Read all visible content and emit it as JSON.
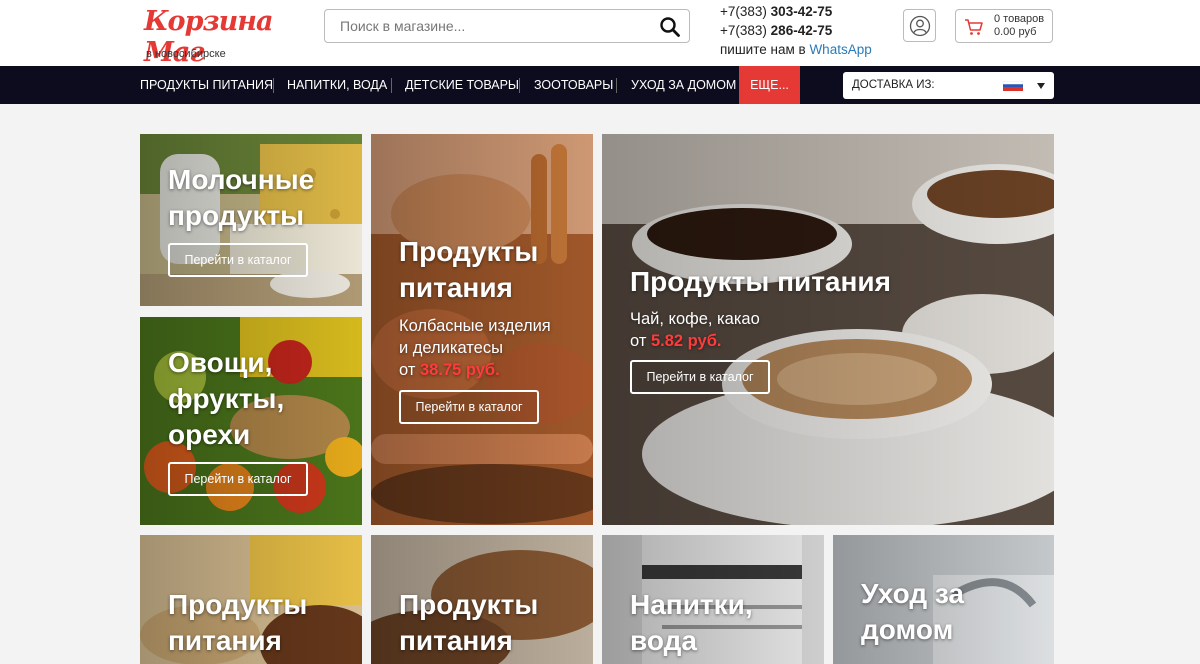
{
  "header": {
    "logo": "Корзина Маг",
    "city": "в новосибирске",
    "search_placeholder": "Поиск в магазине...",
    "phone1_prefix": "+7(383) ",
    "phone1_number": "303-42-75",
    "phone2_prefix": "+7(383) ",
    "phone2_number": "286-42-75",
    "whatsapp_prefix": "пишите нам в ",
    "whatsapp_link": "WhatsApp",
    "cart_count": "0 товаров",
    "cart_sum": "0.00 руб"
  },
  "nav": {
    "items": [
      "ПРОДУКТЫ ПИТАНИЯ",
      "НАПИТКИ, ВОДА",
      "ДЕТСКИЕ ТОВАРЫ",
      "ЗООТОВАРЫ",
      "УХОД ЗА ДОМОМ"
    ],
    "more": "ЕЩЕ...",
    "delivery_label": "ДОСТАВКА ИЗ:"
  },
  "tiles": [
    {
      "title_lines": [
        "Молочные",
        "продукты"
      ],
      "button": "Перейти в каталог"
    },
    {
      "title_lines": [
        "Продукты",
        "питания"
      ],
      "subtitle_lines": [
        "Колбасные изделия",
        "и деликатесы"
      ],
      "price_prefix": "от ",
      "price": "38.75 руб.",
      "button": "Перейти в каталог"
    },
    {
      "title_lines": [
        "Продукты питания"
      ],
      "subtitle_lines": [
        "Чай, кофе, какао"
      ],
      "price_prefix": "от ",
      "price": "5.82 руб.",
      "button": "Перейти в каталог"
    },
    {
      "title_lines": [
        "Овощи,",
        "фрукты,",
        "орехи"
      ],
      "button": "Перейти в каталог"
    },
    {
      "title_lines": [
        "Продукты",
        "питания"
      ]
    },
    {
      "title_lines": [
        "Продукты",
        "питания"
      ]
    },
    {
      "title_lines": [
        "Напитки,",
        "вода"
      ]
    },
    {
      "title_lines": [
        "Уход за",
        "домом"
      ]
    }
  ],
  "colors": {
    "accent_red": "#e53935",
    "nav_bg": "#0c0c1e",
    "price_red": "#ff3b3b",
    "link_blue": "#2a7ab8"
  }
}
